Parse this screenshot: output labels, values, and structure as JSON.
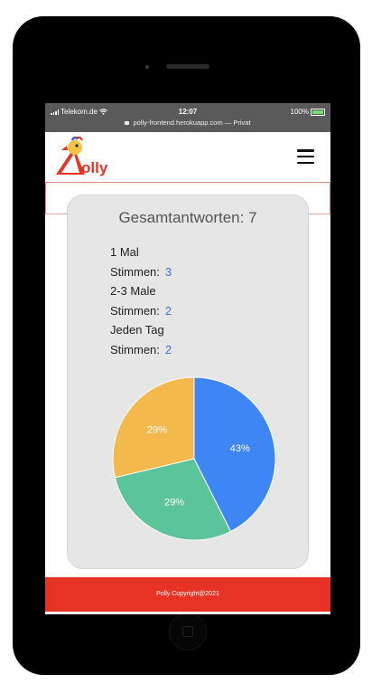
{
  "status_bar": {
    "carrier": "Telekom.de",
    "time": "12:07",
    "battery": "100%",
    "url": "polly-frontend.herokuapp.com — Privat"
  },
  "header": {
    "logo_text": "olly",
    "menu_icon": "hamburger-menu-icon"
  },
  "poll": {
    "total_label": "Gesamtantworten:",
    "total": "7",
    "votes_label": "Stimmen:",
    "answers": [
      {
        "label": "1 Mal",
        "votes": "3"
      },
      {
        "label": "2-3 Male",
        "votes": "2"
      },
      {
        "label": "Jeden Tag",
        "votes": "2"
      }
    ]
  },
  "chart_data": {
    "type": "pie",
    "slices": [
      {
        "label": "43%",
        "value": 43,
        "color": "#3e86f5"
      },
      {
        "label": "29%",
        "value": 29,
        "color": "#5cc49a"
      },
      {
        "label": "29%",
        "value": 29,
        "color": "#f4b94d"
      }
    ]
  },
  "footer": {
    "text": "Polly Copyright@2021"
  },
  "colors": {
    "accent": "#e63325",
    "vote_count": "#3b6fd8"
  }
}
